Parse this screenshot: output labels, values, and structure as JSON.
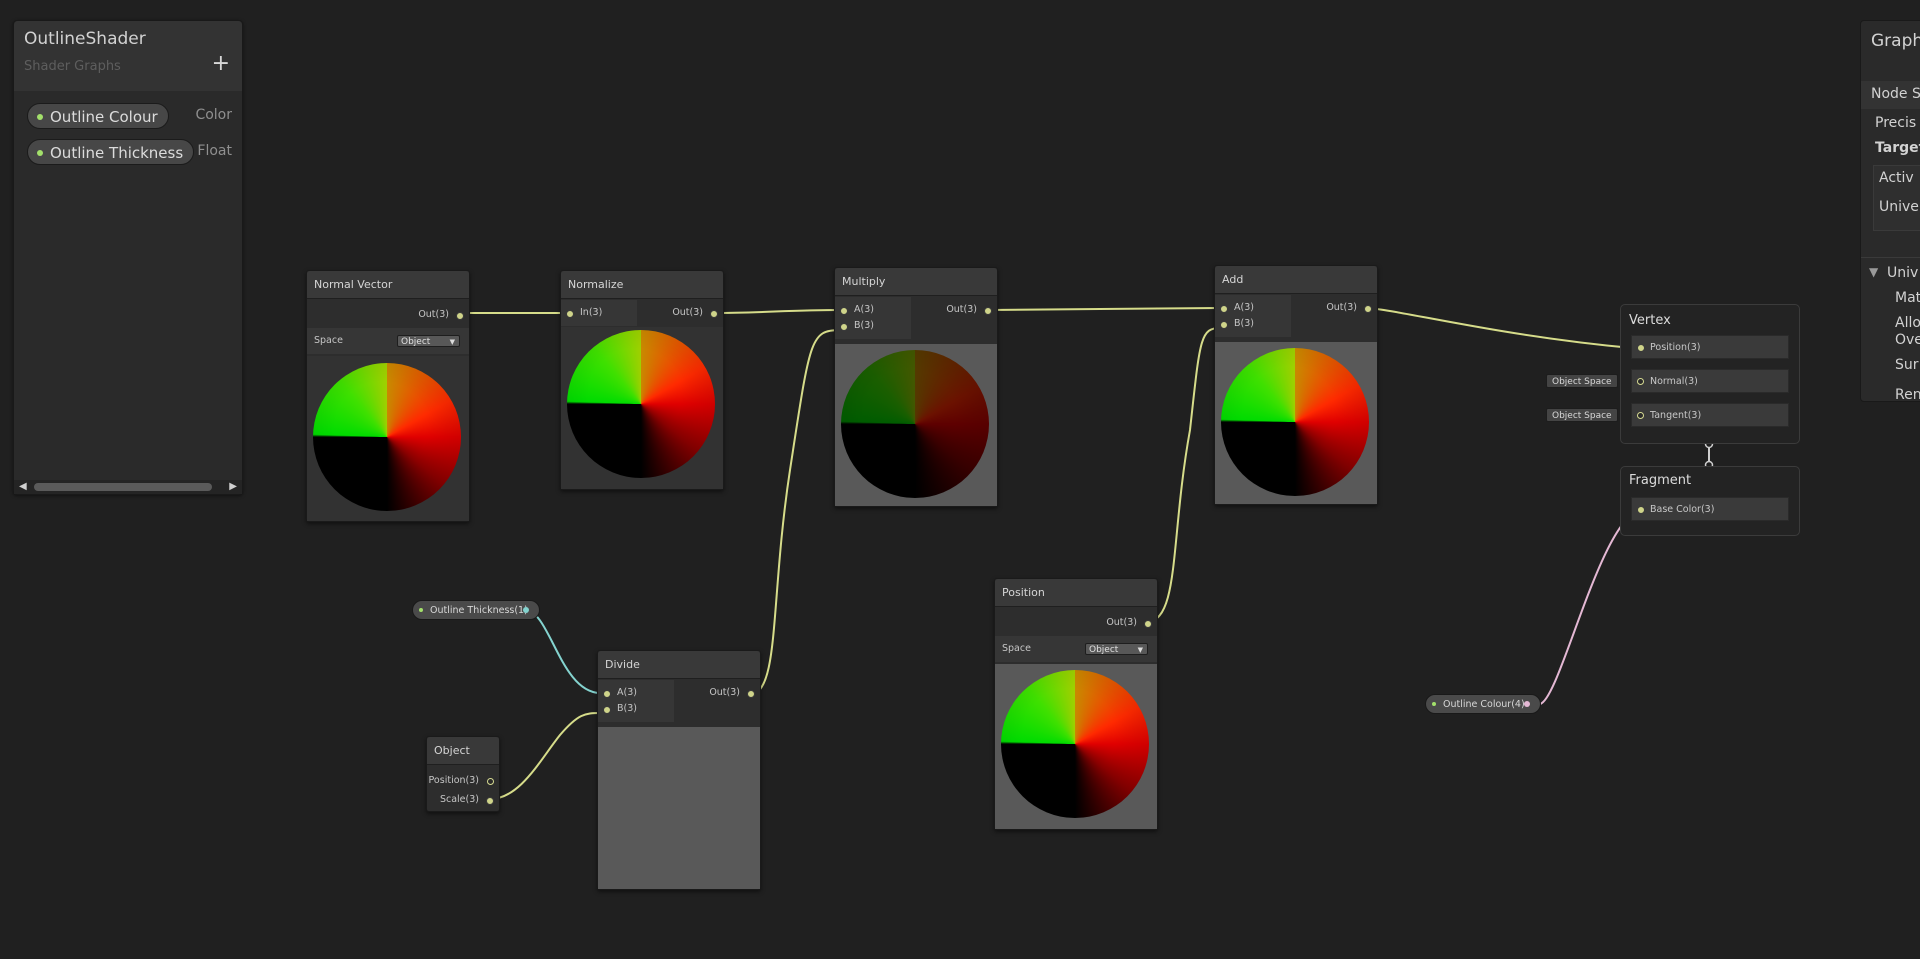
{
  "blackboard": {
    "title": "OutlineShader",
    "subtitle": "Shader Graphs",
    "add_icon": "+",
    "properties": [
      {
        "name": "Outline Colour",
        "type": "Color"
      },
      {
        "name": "Outline Thickness",
        "type": "Float"
      }
    ],
    "scroll_left": "◀",
    "scroll_right": "▶"
  },
  "nodes": {
    "normal_vector": {
      "title": "Normal Vector",
      "out": "Out(3)",
      "space_label": "Space",
      "space_value": "Object"
    },
    "normalize": {
      "title": "Normalize",
      "in": "In(3)",
      "out": "Out(3)"
    },
    "multiply": {
      "title": "Multiply",
      "a": "A(3)",
      "b": "B(3)",
      "out": "Out(3)"
    },
    "add": {
      "title": "Add",
      "a": "A(3)",
      "b": "B(3)",
      "out": "Out(3)"
    },
    "divide": {
      "title": "Divide",
      "a": "A(3)",
      "b": "B(3)",
      "out": "Out(3)"
    },
    "position": {
      "title": "Position",
      "out": "Out(3)",
      "space_label": "Space",
      "space_value": "Object"
    },
    "object": {
      "title": "Object",
      "position": "Position(3)",
      "scale": "Scale(3)"
    }
  },
  "pills": {
    "outline_thickness": "Outline Thickness(1)",
    "outline_colour": "Outline Colour(4)"
  },
  "master_stack": {
    "vertex": {
      "title": "Vertex",
      "blocks": [
        "Position(3)",
        "Normal(3)",
        "Tangent(3)"
      ],
      "object_space": "Object Space"
    },
    "fragment": {
      "title": "Fragment",
      "blocks": [
        "Base Color(3)"
      ]
    }
  },
  "inspector": {
    "title": "Graph",
    "tab": "Node S",
    "precision": "Precis",
    "targets": "Target",
    "active": "Activ",
    "universal": "Unive",
    "section": "Univ",
    "material": "Mat",
    "allow": "Allo",
    "override": "Ove",
    "surface": "Sur",
    "render": "Ren"
  },
  "colors": {
    "background": "#202020",
    "wire_vector3": "#d6dc8a",
    "wire_float": "#84d3cf",
    "wire_color": "#e4b8d4",
    "property_dot": "#a3e06b"
  },
  "icons": {
    "add": "plus-icon",
    "dropdown": "caret-down-icon",
    "section_toggle": "triangle-down-icon"
  }
}
